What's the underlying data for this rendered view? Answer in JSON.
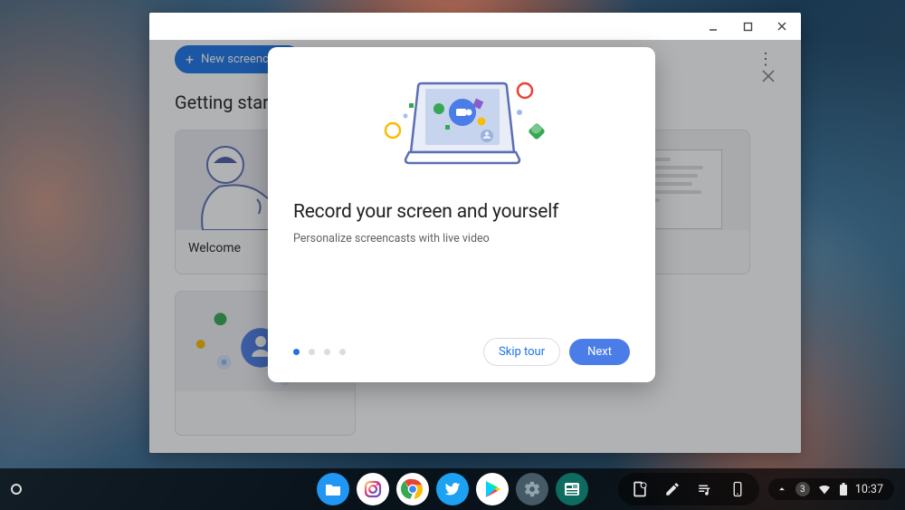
{
  "app": {
    "new_button_label": "New screencast",
    "section_title": "Getting started",
    "card1_label": "Welcome"
  },
  "tour": {
    "title": "Record your screen and yourself",
    "subtitle": "Personalize screencasts with live video",
    "skip_label": "Skip tour",
    "next_label": "Next",
    "current_step": 1,
    "total_steps": 4
  },
  "shelf": {
    "notification_count": "3",
    "clock": "10:37"
  }
}
